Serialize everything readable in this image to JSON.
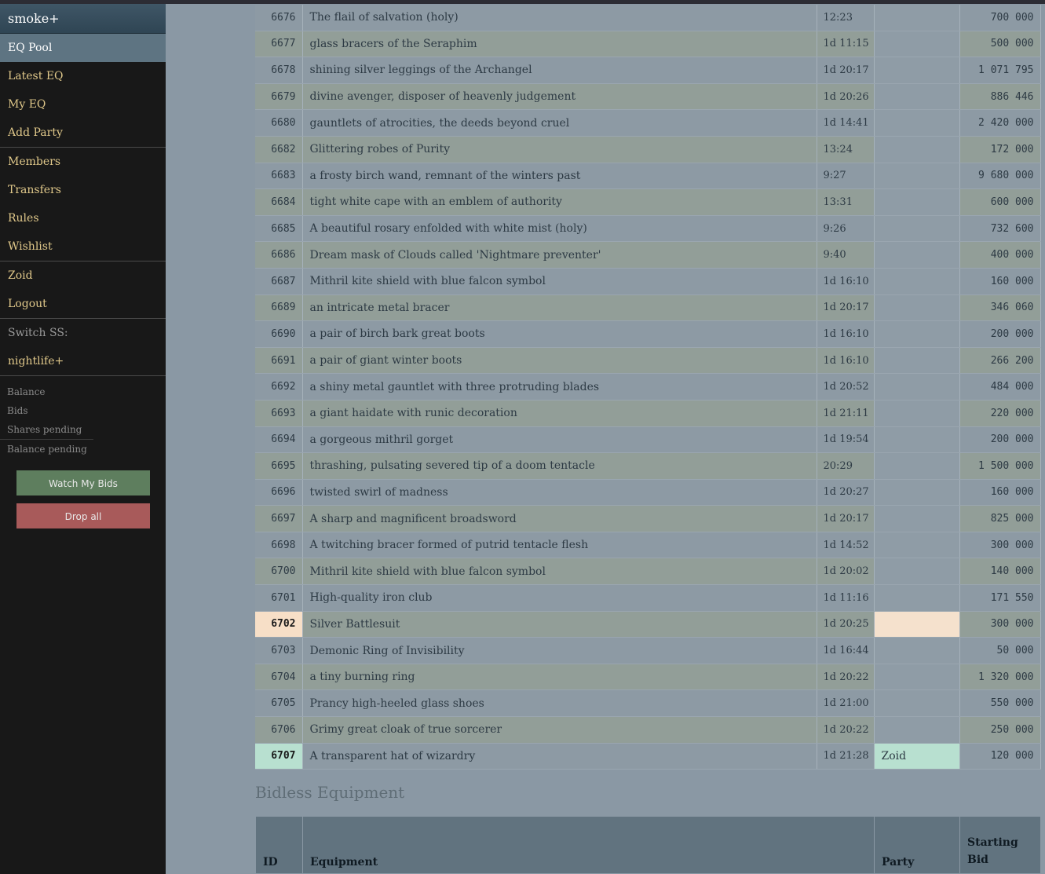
{
  "sidebar": {
    "brand": "smoke+",
    "active": "EQ Pool",
    "group1": [
      "Latest EQ",
      "My EQ",
      "Add Party"
    ],
    "group2": [
      "Members",
      "Transfers",
      "Rules",
      "Wishlist"
    ],
    "group3": [
      "Zoid",
      "Logout"
    ],
    "switch_label": "Switch SS:",
    "switch_target": "nightlife+",
    "stats": [
      "Balance",
      "Bids",
      "Shares pending",
      "Balance pending"
    ],
    "watch_button": "Watch My Bids",
    "drop_button": "Drop all"
  },
  "rows": [
    {
      "id": "6676",
      "eq": "The flail of salvation (holy)",
      "time": "12:23",
      "party": "",
      "bid": "700 000"
    },
    {
      "id": "6677",
      "eq": "glass bracers of the Seraphim",
      "time": "1d 11:15",
      "party": "",
      "bid": "500 000"
    },
    {
      "id": "6678",
      "eq": "shining silver leggings of the Archangel",
      "time": "1d 20:17",
      "party": "",
      "bid": "1 071 795"
    },
    {
      "id": "6679",
      "eq": "divine avenger, disposer of heavenly judgement",
      "time": "1d 20:26",
      "party": "",
      "bid": "886 446"
    },
    {
      "id": "6680",
      "eq": "gauntlets of atrocities, the deeds beyond cruel",
      "time": "1d 14:41",
      "party": "",
      "bid": "2 420 000"
    },
    {
      "id": "6682",
      "eq": "Glittering robes of Purity",
      "time": "13:24",
      "party": "",
      "bid": "172 000"
    },
    {
      "id": "6683",
      "eq": "a frosty birch wand, remnant of the winters past",
      "time": "9:27",
      "party": "",
      "bid": "9 680 000"
    },
    {
      "id": "6684",
      "eq": "tight white cape with an emblem of authority",
      "time": "13:31",
      "party": "",
      "bid": "600 000"
    },
    {
      "id": "6685",
      "eq": "A beautiful rosary enfolded with white mist (holy)",
      "time": "9:26",
      "party": "",
      "bid": "732 600"
    },
    {
      "id": "6686",
      "eq": "Dream mask of Clouds called 'Nightmare preventer'",
      "time": "9:40",
      "party": "",
      "bid": "400 000"
    },
    {
      "id": "6687",
      "eq": "Mithril kite shield with blue falcon symbol",
      "time": "1d 16:10",
      "party": "",
      "bid": "160 000"
    },
    {
      "id": "6689",
      "eq": "an intricate metal bracer",
      "time": "1d 20:17",
      "party": "",
      "bid": "346 060"
    },
    {
      "id": "6690",
      "eq": "a pair of birch bark great boots",
      "time": "1d 16:10",
      "party": "",
      "bid": "200 000"
    },
    {
      "id": "6691",
      "eq": "a pair of giant winter boots",
      "time": "1d 16:10",
      "party": "",
      "bid": "266 200"
    },
    {
      "id": "6692",
      "eq": "a shiny metal gauntlet with three protruding blades",
      "time": "1d 20:52",
      "party": "",
      "bid": "484 000"
    },
    {
      "id": "6693",
      "eq": "a giant haidate with runic decoration",
      "time": "1d 21:11",
      "party": "",
      "bid": "220 000"
    },
    {
      "id": "6694",
      "eq": "a gorgeous mithril gorget",
      "time": "1d 19:54",
      "party": "",
      "bid": "200 000"
    },
    {
      "id": "6695",
      "eq": "thrashing, pulsating severed tip of a doom tentacle",
      "time": "20:29",
      "party": "",
      "bid": "1 500 000"
    },
    {
      "id": "6696",
      "eq": "twisted swirl of madness",
      "time": "1d 20:27",
      "party": "",
      "bid": "160 000"
    },
    {
      "id": "6697",
      "eq": "A sharp and magnificent broadsword",
      "time": "1d 20:17",
      "party": "",
      "bid": "825 000"
    },
    {
      "id": "6698",
      "eq": "A twitching bracer formed of putrid tentacle flesh",
      "time": "1d 14:52",
      "party": "",
      "bid": "300 000"
    },
    {
      "id": "6700",
      "eq": "Mithril kite shield with blue falcon symbol",
      "time": "1d 20:02",
      "party": "",
      "bid": "140 000"
    },
    {
      "id": "6701",
      "eq": "High-quality iron club",
      "time": "1d 11:16",
      "party": "",
      "bid": "171 550"
    },
    {
      "id": "6702",
      "eq": "Silver Battlesuit",
      "time": "1d 20:25",
      "party": "",
      "bid": "300 000",
      "highlight": "peach"
    },
    {
      "id": "6703",
      "eq": "Demonic Ring of Invisibility",
      "time": "1d 16:44",
      "party": "",
      "bid": "50 000"
    },
    {
      "id": "6704",
      "eq": "a tiny burning ring",
      "time": "1d 20:22",
      "party": "",
      "bid": "1 320 000"
    },
    {
      "id": "6705",
      "eq": "Prancy high-heeled glass shoes",
      "time": "1d 21:00",
      "party": "",
      "bid": "550 000"
    },
    {
      "id": "6706",
      "eq": "Grimy great cloak of true sorcerer",
      "time": "1d 20:22",
      "party": "",
      "bid": "250 000"
    },
    {
      "id": "6707",
      "eq": "A transparent hat of wizardry",
      "time": "1d 21:28",
      "party": "Zoid",
      "bid": "120 000",
      "highlight": "mint"
    }
  ],
  "bidless": {
    "title": "Bidless Equipment",
    "headers": [
      "ID",
      "Equipment",
      "Party",
      "Starting Bid"
    ]
  }
}
